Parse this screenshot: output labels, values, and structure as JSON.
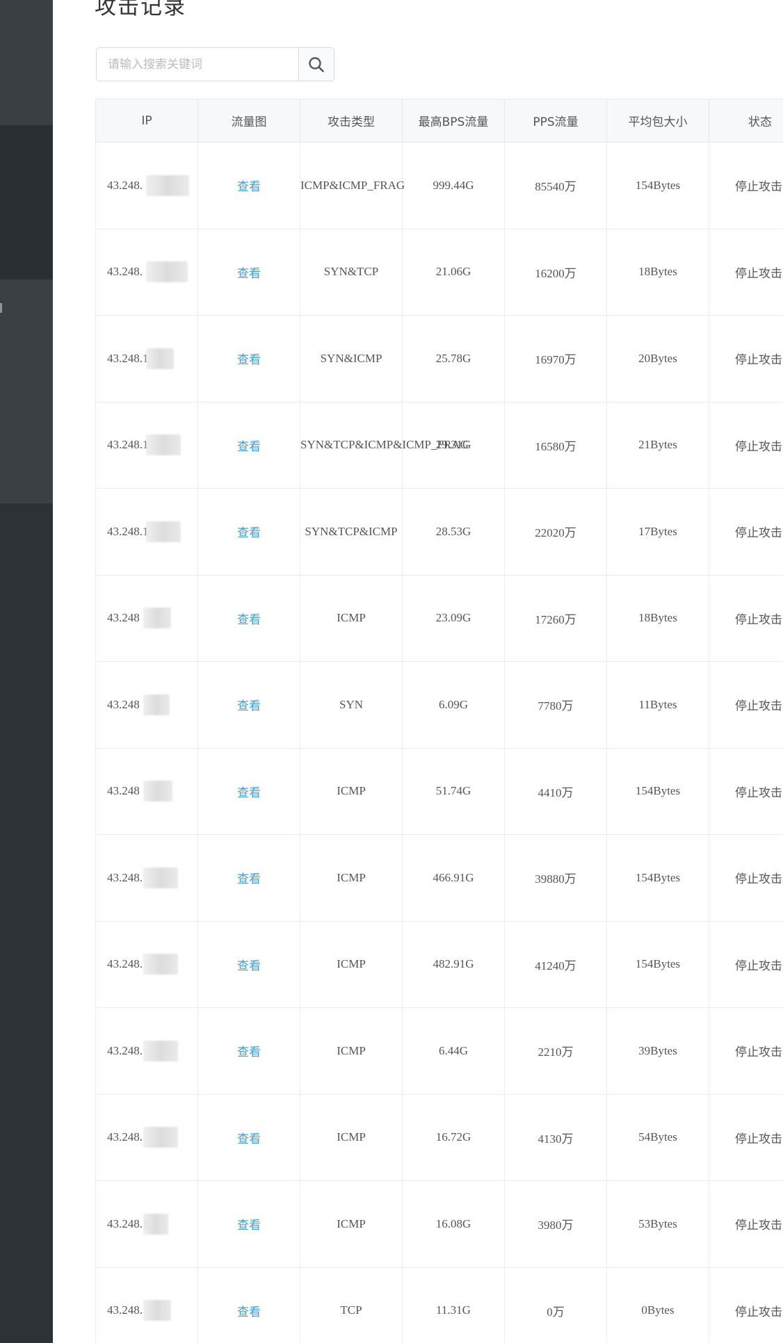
{
  "page": {
    "title": "攻击记录"
  },
  "search": {
    "placeholder": "请输入搜索关键词",
    "icon": "search-icon"
  },
  "table": {
    "headers": [
      "IP",
      "流量图",
      "攻击类型",
      "最高BPS流量",
      "PPS流量",
      "平均包大小",
      "状态"
    ],
    "view_label": "查看",
    "rows": [
      {
        "ip": "43.248.",
        "view": "查看",
        "type": "ICMP&ICMP_FRAG",
        "bps": "999.44G",
        "pps": "85540万",
        "size": "154Bytes",
        "status": "停止攻击"
      },
      {
        "ip": "43.248.",
        "view": "查看",
        "type": "SYN&TCP",
        "bps": "21.06G",
        "pps": "16200万",
        "size": "18Bytes",
        "status": "停止攻击"
      },
      {
        "ip": "43.248.1",
        "view": "查看",
        "type": "SYN&ICMP",
        "bps": "25.78G",
        "pps": "16970万",
        "size": "20Bytes",
        "status": "停止攻击"
      },
      {
        "ip": "43.248.1",
        "view": "查看",
        "type": "SYN&TCP&ICMP&ICMP_FRAG",
        "bps": "29.31G",
        "pps": "16580万",
        "size": "21Bytes",
        "status": "停止攻击"
      },
      {
        "ip": "43.248.1",
        "view": "查看",
        "type": "SYN&TCP&ICMP",
        "bps": "28.53G",
        "pps": "22020万",
        "size": "17Bytes",
        "status": "停止攻击"
      },
      {
        "ip": "43.248",
        "view": "查看",
        "type": "ICMP",
        "bps": "23.09G",
        "pps": "17260万",
        "size": "18Bytes",
        "status": "停止攻击"
      },
      {
        "ip": "43.248",
        "view": "查看",
        "type": "SYN",
        "bps": "6.09G",
        "pps": "7780万",
        "size": "11Bytes",
        "status": "停止攻击"
      },
      {
        "ip": "43.248",
        "view": "查看",
        "type": "ICMP",
        "bps": "51.74G",
        "pps": "4410万",
        "size": "154Bytes",
        "status": "停止攻击"
      },
      {
        "ip": "43.248.",
        "view": "查看",
        "type": "ICMP",
        "bps": "466.91G",
        "pps": "39880万",
        "size": "154Bytes",
        "status": "停止攻击"
      },
      {
        "ip": "43.248.",
        "view": "查看",
        "type": "ICMP",
        "bps": "482.91G",
        "pps": "41240万",
        "size": "154Bytes",
        "status": "停止攻击"
      },
      {
        "ip": "43.248.",
        "view": "查看",
        "type": "ICMP",
        "bps": "6.44G",
        "pps": "2210万",
        "size": "39Bytes",
        "status": "停止攻击"
      },
      {
        "ip": "43.248.",
        "view": "查看",
        "type": "ICMP",
        "bps": "16.72G",
        "pps": "4130万",
        "size": "54Bytes",
        "status": "停止攻击"
      },
      {
        "ip": "43.248.1",
        "view": "查看",
        "type": "ICMP",
        "bps": "16.08G",
        "pps": "3980万",
        "size": "53Bytes",
        "status": "停止攻击"
      },
      {
        "ip": "43.248.",
        "view": "查看",
        "type": "TCP",
        "bps": "11.31G",
        "pps": "0万",
        "size": "0Bytes",
        "status": "停止攻击"
      }
    ]
  }
}
